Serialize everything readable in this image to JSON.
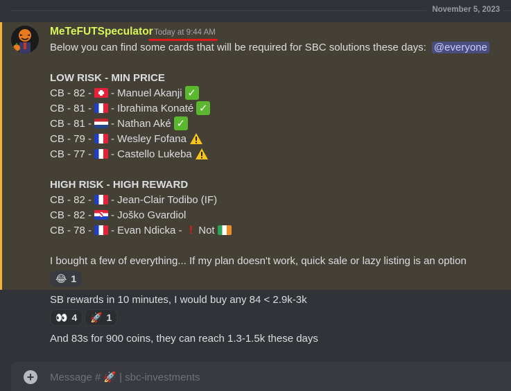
{
  "date_divider": "November 5, 2023",
  "message": {
    "author": "MeTeFUTSpeculator",
    "timestamp": "Today at 9:44 AM",
    "intro": "Below you can find some cards that will be required for SBC solutions these days:",
    "mention": "@everyone",
    "low_risk_heading": "LOW RISK - MIN PRICE",
    "low_risk": [
      {
        "prefix": "CB - 82 -",
        "flag": "switzerland-flag",
        "name": "- Manuel Akanji",
        "mark": "check"
      },
      {
        "prefix": "CB - 81 -",
        "flag": "france-flag",
        "name": "- Ibrahima Konaté",
        "mark": "check"
      },
      {
        "prefix": "CB - 81 -",
        "flag": "netherlands-flag",
        "name": "- Nathan Aké",
        "mark": "check"
      },
      {
        "prefix": "CB - 79 -",
        "flag": "france-flag",
        "name": "- Wesley Fofana",
        "mark": "warning"
      },
      {
        "prefix": "CB - 77 -",
        "flag": "france-flag",
        "name": "- Castello Lukeba",
        "mark": "warning"
      }
    ],
    "high_risk_heading": "HIGH RISK - HIGH REWARD",
    "high_risk": [
      {
        "prefix": "CB - 82 -",
        "flag": "france-flag",
        "name": "- Jean-Clair Todibo (IF)"
      },
      {
        "prefix": "CB - 82 -",
        "flag": "croatia-flag",
        "name": "- Joško Gvardiol"
      },
      {
        "prefix": "CB - 78 -",
        "flag": "france-flag",
        "name": "- Evan Ndicka -",
        "extra_mark": "exclamation",
        "extra_text": "Not",
        "extra_flag": "ireland-flag"
      }
    ],
    "closing": "I bought a few of everything... If my plan doesn't work, quick sale or lazy listing is an option",
    "reaction": {
      "emoji": "😂",
      "icon": "joy-emoji",
      "count": "1"
    }
  },
  "followups": [
    {
      "text": "SB rewards in 10 minutes, I would buy any 84 < 2.9k-3k",
      "reactions": [
        {
          "emoji": "👀",
          "icon": "eyes-emoji",
          "count": "4"
        },
        {
          "emoji": "🚀",
          "icon": "rocket-emoji",
          "count": "1"
        }
      ]
    },
    {
      "text": "And 83s for 900 coins, they can reach 1.3-1.5k these days"
    }
  ],
  "composer": {
    "placeholder_prefix": "Message #",
    "channel_emoji": "🚀",
    "placeholder_suffix": "| sbc-investments"
  },
  "colors": {
    "background": "#313338",
    "highlight": "#444036",
    "highlight_bar": "#f0b232",
    "author": "#d7f55a",
    "mention_bg": "#4a4d80",
    "underline": "#e01b1b"
  }
}
